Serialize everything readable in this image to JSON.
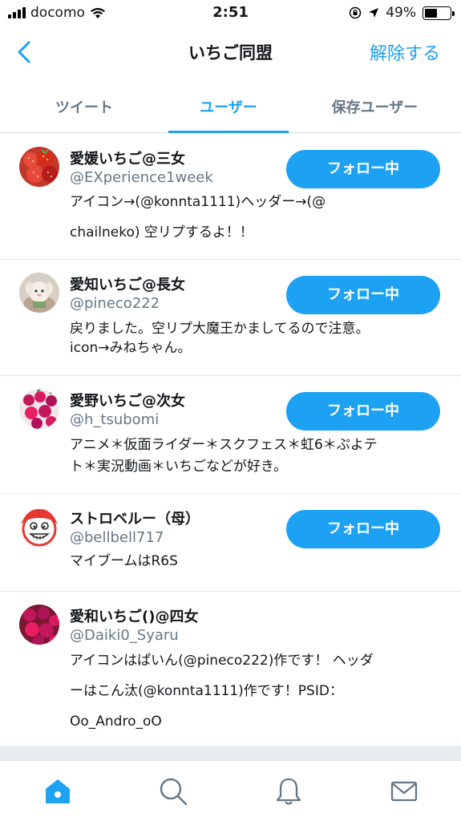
{
  "status": {
    "carrier": "docomo",
    "time": "2:51",
    "battery_pct": "49%",
    "battery_level": 0.49
  },
  "nav": {
    "title": "いちご同盟",
    "action": "解除する"
  },
  "tabs": [
    {
      "label": "ツイート"
    },
    {
      "label": "ユーザー"
    },
    {
      "label": "保存ユーザー"
    }
  ],
  "follow_label": "フォロー中",
  "users": [
    {
      "name": "愛媛いちご@三女",
      "handle": "@EXperience1week",
      "bio1": "アイコン→(@konnta1111)ヘッダー→(@",
      "bio2": "chailneko) 空リプするよ！！",
      "bio3": ""
    },
    {
      "name": "愛知いちご@長女",
      "handle": "@pineco222",
      "bio1": "戻りました。空リプ大魔王かましてるので注意。",
      "bio2": "icon→みねちゃん。",
      "bio3": ""
    },
    {
      "name": "愛野いちご@次女",
      "handle": "@h_tsubomi",
      "bio1": "アニメ＊仮面ライダー＊スクフェス＊虹6＊ぷよテ",
      "bio2": "ト＊実況動画＊いちごなどが好き。",
      "bio3": ""
    },
    {
      "name": "ストロベルー（母）",
      "handle": "@bellbell717",
      "bio1": "マイブームはR6S",
      "bio2": "",
      "bio3": ""
    },
    {
      "name": "愛和いちご()@四女",
      "handle": "@Daiki0_Syaru",
      "bio1": "アイコンはぱいん(@pineco222)作です！ ヘッダ",
      "bio2": "ーはこん汰(@konnta1111)作です！PSID：",
      "bio3": "Oo_Andro_oO"
    }
  ],
  "icons": {
    "back": "chevron-left-icon",
    "home": "home-icon",
    "search": "search-icon",
    "notifications": "bell-icon",
    "messages": "mail-icon"
  },
  "colors": {
    "accent": "#1da1f2",
    "secondary_text": "#657786"
  }
}
